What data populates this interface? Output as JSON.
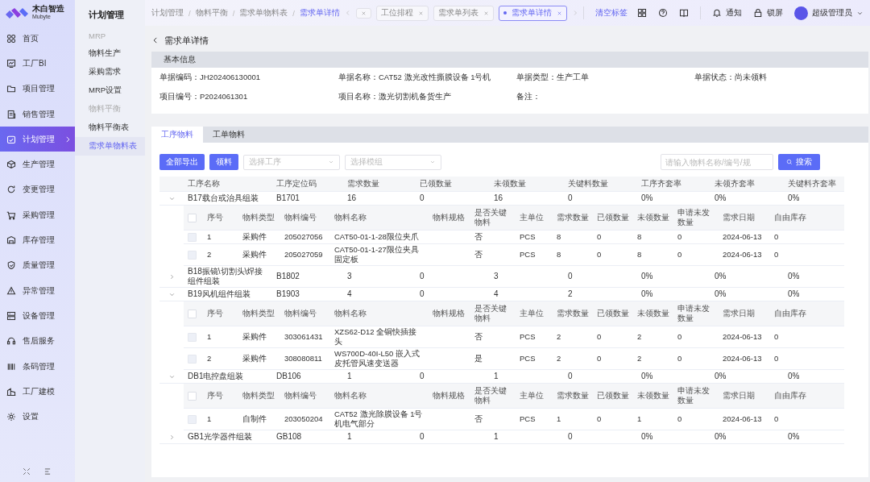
{
  "logo": {
    "name": "木白智造",
    "sub": "Mubyte"
  },
  "sidebar": {
    "items": [
      {
        "label": "首页",
        "selected": false
      },
      {
        "label": "工厂BI",
        "selected": false
      },
      {
        "label": "项目管理",
        "selected": false
      },
      {
        "label": "销售管理",
        "selected": false
      },
      {
        "label": "计划管理",
        "selected": true
      },
      {
        "label": "生产管理",
        "selected": false
      },
      {
        "label": "变更管理",
        "selected": false
      },
      {
        "label": "采购管理",
        "selected": false
      },
      {
        "label": "库存管理",
        "selected": false
      },
      {
        "label": "质量管理",
        "selected": false
      },
      {
        "label": "异常管理",
        "selected": false
      },
      {
        "label": "设备管理",
        "selected": false
      },
      {
        "label": "售后服务",
        "selected": false
      },
      {
        "label": "条码管理",
        "selected": false
      },
      {
        "label": "工厂建模",
        "selected": false
      },
      {
        "label": "设置",
        "selected": false
      }
    ]
  },
  "submenu": {
    "title": "计划管理",
    "groups": [
      {
        "title": "MRP",
        "items": [
          {
            "label": "物料生产",
            "selected": false
          },
          {
            "label": "采购需求",
            "selected": false
          },
          {
            "label": "MRP设置",
            "selected": false
          }
        ]
      },
      {
        "title": "物料平衡",
        "items": [
          {
            "label": "物料平衡表",
            "selected": false
          },
          {
            "label": "需求单物料表",
            "selected": true
          }
        ]
      }
    ]
  },
  "breadcrumb": [
    "计划管理",
    "物料平衡",
    "需求单物料表",
    "需求单详情"
  ],
  "breadcrumb_separator": "/",
  "tabs": [
    {
      "selected": false
    },
    {
      "label": "工位排程",
      "selected": false
    },
    {
      "label": "需求单列表",
      "selected": false
    },
    {
      "label": "需求单详情",
      "selected": true
    }
  ],
  "clear_tabs": "清空标签",
  "header": {
    "notify": "通知",
    "lock": "锁屏",
    "user": "超级管理员"
  },
  "page_title": "需求单详情",
  "basic_info": {
    "title": "基本信息",
    "fields": [
      {
        "label": "单据编码：",
        "value": "JH202406130001"
      },
      {
        "label": "单据名称：",
        "value": "CAT52 激光改性撕膜设备 1号机"
      },
      {
        "label": "单据类型：",
        "value": "生产工单"
      },
      {
        "label": "单据状态：",
        "value": "尚未领料"
      },
      {
        "label": "项目编号：",
        "value": "P2024061301"
      },
      {
        "label": "项目名称：",
        "value": "激光切割机备货生产"
      },
      {
        "label": "备注："
      }
    ]
  },
  "detail_tabs": [
    {
      "label": "工序物料",
      "selected": true
    },
    {
      "label": "工单物料",
      "selected": false
    }
  ],
  "toolbar": {
    "export": "全部导出",
    "pick": "领料",
    "process_select": {
      "placeholder": "选择工序"
    },
    "module_select": {
      "placeholder": "选择模组"
    },
    "search": {
      "placeholder": "请输入物料名称/编号/规"
    },
    "search_button": "搜索"
  },
  "table": {
    "columns": [
      "工序名称",
      "工序定位码",
      "需求数量",
      "已领数量",
      "未领数量",
      "关键料数量",
      "工序齐套率",
      "未领齐套率",
      "关键料齐套率"
    ],
    "rows": [
      {
        "cells": [
          "B17载台或治具组装",
          "B1701",
          "16",
          "0",
          "16",
          "0",
          "0%",
          "0%",
          "0%"
        ],
        "expanded": true,
        "sub_columns": [
          "序号",
          "物料类型",
          "物料编号",
          "物料名称",
          "物料规格",
          "是否关键物料",
          "主单位",
          "需求数量",
          "已领数量",
          "未领数量",
          "申请未发数量",
          "需求日期",
          "自由库存"
        ],
        "select_all_checked": false,
        "items": [
          {
            "checked": false,
            "disabled": true,
            "cells": [
              "1",
              "采购件",
              "205027056",
              "CAT50-01-1-28限位夹爪",
              "",
              "否",
              "PCS",
              "8",
              "0",
              "8",
              "0",
              "2024-06-13",
              "0"
            ]
          },
          {
            "checked": false,
            "disabled": true,
            "cells": [
              "2",
              "采购件",
              "205027059",
              "CAT50-01-1-27限位夹具固定板",
              "",
              "否",
              "PCS",
              "8",
              "0",
              "8",
              "0",
              "2024-06-13",
              "0"
            ]
          }
        ]
      },
      {
        "cells": [
          "B18振镜\\切割头\\焊接组件组装",
          "B1802",
          "3",
          "0",
          "3",
          "0",
          "0%",
          "0%",
          "0%"
        ],
        "expanded": false
      },
      {
        "cells": [
          "B19风机组件组装",
          "B1903",
          "4",
          "0",
          "4",
          "2",
          "0%",
          "0%",
          "0%"
        ],
        "expanded": true,
        "sub_columns": [
          "序号",
          "物料类型",
          "物料编号",
          "物料名称",
          "物料规格",
          "是否关键物料",
          "主单位",
          "需求数量",
          "已领数量",
          "未领数量",
          "申请未发数量",
          "需求日期",
          "自由库存"
        ],
        "select_all_checked": false,
        "items": [
          {
            "checked": false,
            "disabled": true,
            "cells": [
              "1",
              "采购件",
              "303061431",
              "XZS62-D12 全铜快插接头",
              "",
              "否",
              "PCS",
              "2",
              "0",
              "2",
              "0",
              "2024-06-13",
              "0"
            ]
          },
          {
            "checked": false,
            "disabled": true,
            "cells": [
              "2",
              "采购件",
              "308080811",
              "WS700D-40I-L50 嵌入式皮托管风速变送器",
              "",
              "是",
              "PCS",
              "2",
              "0",
              "2",
              "0",
              "2024-06-13",
              "0"
            ]
          }
        ]
      },
      {
        "cells": [
          "DB1电控盘组装",
          "DB106",
          "1",
          "0",
          "1",
          "0",
          "0%",
          "0%",
          "0%"
        ],
        "expanded": true,
        "sub_columns": [
          "序号",
          "物料类型",
          "物料编号",
          "物料名称",
          "物料规格",
          "是否关键物料",
          "主单位",
          "需求数量",
          "已领数量",
          "未领数量",
          "申请未发数量",
          "需求日期",
          "自由库存"
        ],
        "select_all_checked": false,
        "items": [
          {
            "checked": false,
            "disabled": true,
            "cells": [
              "1",
              "自制件",
              "203050204",
              "CAT52 激光除膜设备 1号机电气部分",
              "",
              "否",
              "PCS",
              "1",
              "0",
              "1",
              "0",
              "2024-06-13",
              "0"
            ]
          }
        ]
      },
      {
        "cells": [
          "GB1光学器件组装",
          "GB108",
          "1",
          "0",
          "1",
          "0",
          "0%",
          "0%",
          "0%"
        ],
        "expanded": false
      }
    ]
  }
}
